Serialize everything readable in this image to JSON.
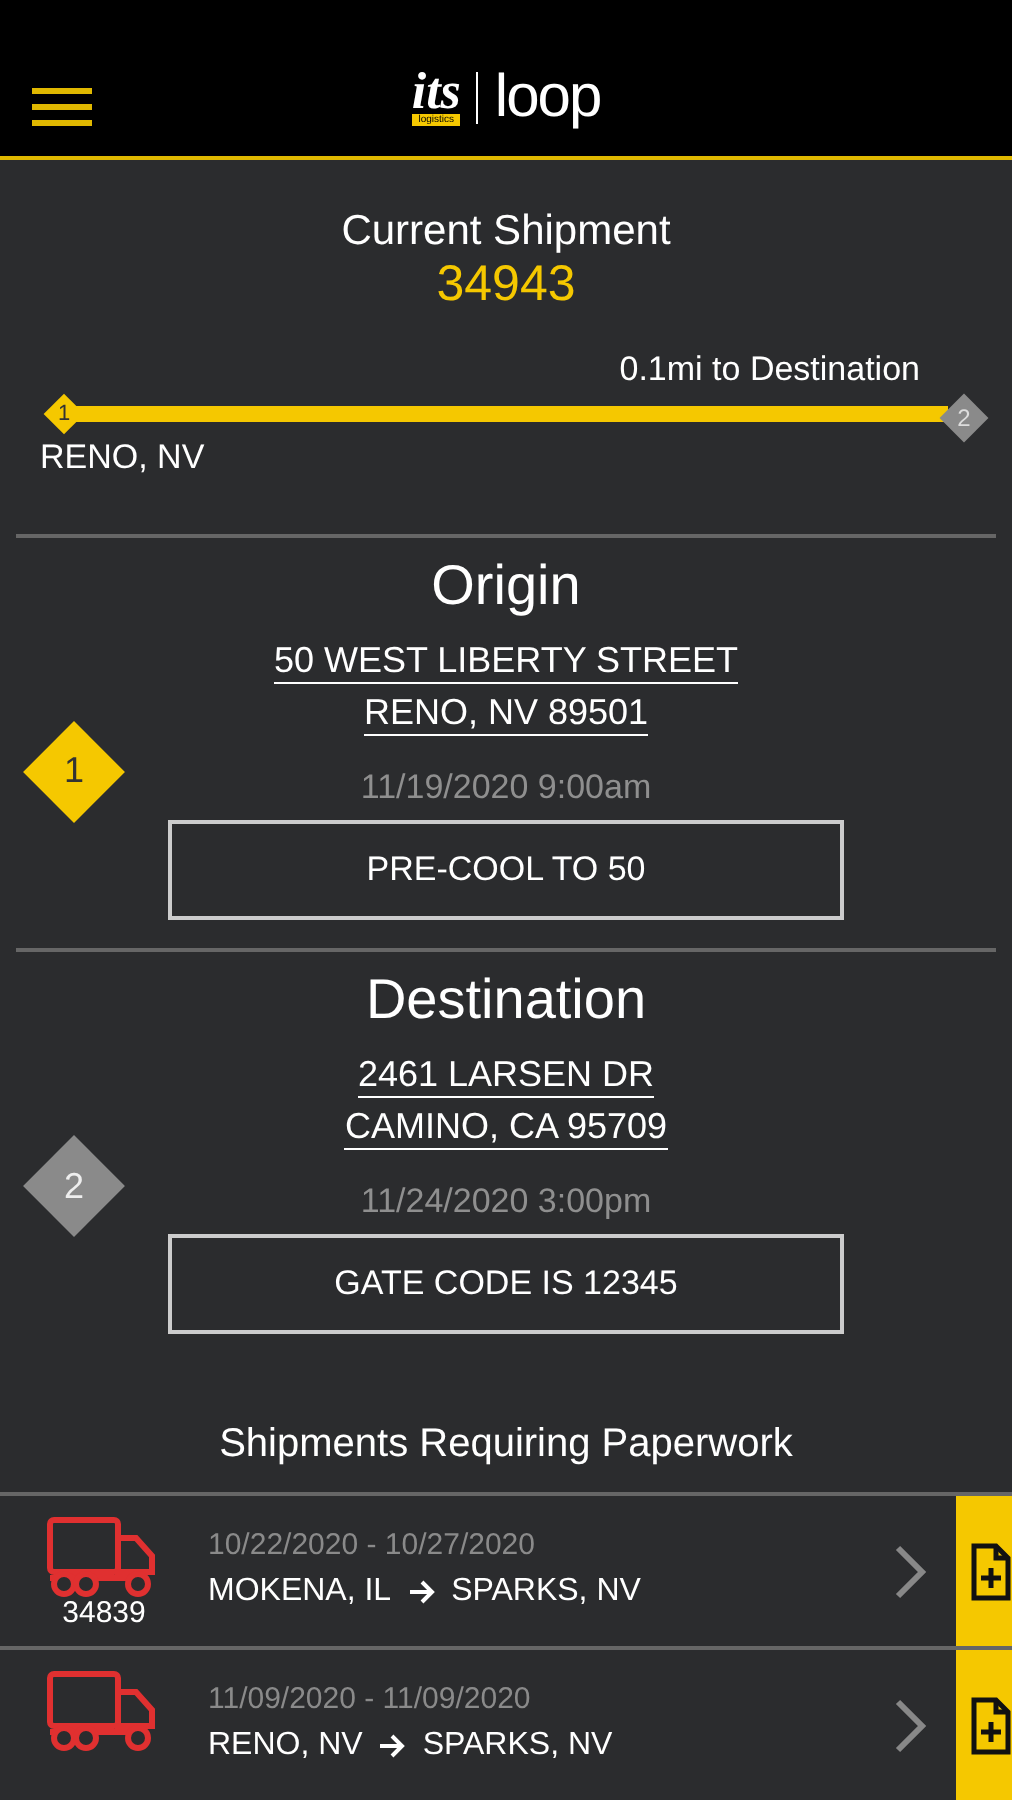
{
  "header": {
    "logo_left": "its",
    "logo_left_sub": "logistics",
    "logo_right": "loop"
  },
  "current_shipment": {
    "title": "Current Shipment",
    "number": "34943",
    "distance": "0.1mi to Destination",
    "level": 1,
    "start_marker": "1",
    "end_marker": "2",
    "location": "RENO, NV"
  },
  "stops": [
    {
      "heading": "Origin",
      "marker": "1",
      "color": "#f5c800",
      "address_line_1": "50 WEST LIBERTY STREET",
      "address_line_2": "RENO, NV 89501",
      "time": "11/19/2020 9:00am",
      "note": "PRE-COOL TO 50"
    },
    {
      "heading": "Destination",
      "marker": "2",
      "color": "#8a8a8a",
      "address_line_1": "2461 LARSEN DR",
      "address_line_2": "CAMINO, CA 95709",
      "time": "11/24/2020 3:00pm",
      "note": "GATE CODE IS 12345"
    }
  ],
  "paperwork": {
    "title": "Shipments Requiring Paperwork",
    "rows": [
      {
        "number": "34839",
        "dates": "10/22/2020 - 10/27/2020",
        "from": "MOKENA, IL",
        "to": "SPARKS, NV"
      },
      {
        "dates": "11/09/2020 - 11/09/2020",
        "from": "RENO, NV",
        "to": "SPARKS, NV"
      }
    ]
  }
}
